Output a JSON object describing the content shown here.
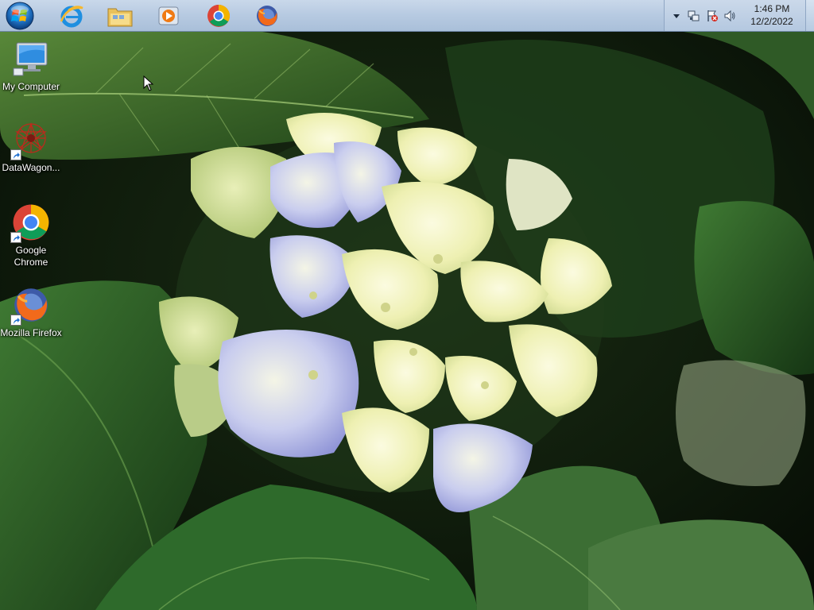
{
  "taskbar": {
    "start_button": {
      "icon": "windows-orb-icon"
    },
    "pinned_apps": [
      {
        "name": "Internet Explorer",
        "icon": "internet-explorer-icon"
      },
      {
        "name": "Windows Explorer",
        "icon": "folder-icon"
      },
      {
        "name": "Windows Media Player",
        "icon": "media-player-icon"
      },
      {
        "name": "Google Chrome",
        "icon": "chrome-icon"
      },
      {
        "name": "Mozilla Firefox",
        "icon": "firefox-icon"
      }
    ]
  },
  "tray": {
    "icons": [
      "show-hidden-icons-chevron",
      "network-icon",
      "action-center-flag-icon",
      "volume-icon"
    ],
    "time": "1:46 PM",
    "date": "12/2/2022"
  },
  "desktop": {
    "icons": [
      {
        "label": "My Computer",
        "icon": "computer-icon",
        "shortcut": false
      },
      {
        "label": "DataWagon...",
        "icon": "datawagon-icon",
        "shortcut": true
      },
      {
        "label": "Google Chrome",
        "icon": "chrome-icon",
        "shortcut": true
      },
      {
        "label": "Mozilla Firefox",
        "icon": "firefox-icon",
        "shortcut": true
      }
    ]
  },
  "colors": {
    "taskbar_top": "#c9d8ea",
    "taskbar_bottom": "#a9bfd9",
    "label_text": "#ffffff"
  }
}
